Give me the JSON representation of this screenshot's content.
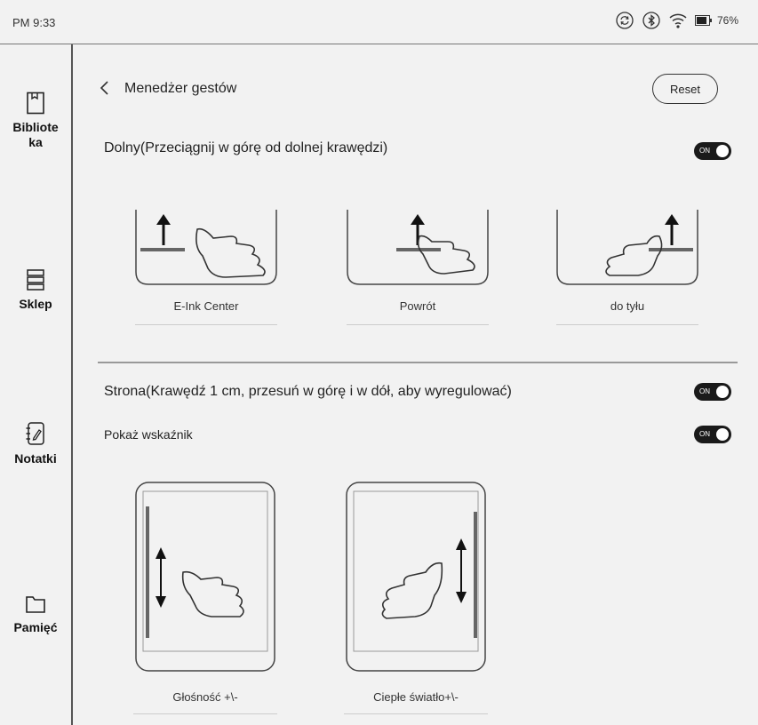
{
  "status": {
    "time": "PM 9:33",
    "battery": "76%"
  },
  "nav": {
    "items": [
      {
        "label_line1": "Bibliote",
        "label_line2": "ka",
        "icon": "library-icon"
      },
      {
        "label_line1": "Sklep",
        "label_line2": "",
        "icon": "store-icon"
      },
      {
        "label_line1": "Notatki",
        "label_line2": "",
        "icon": "notes-icon"
      },
      {
        "label_line1": "Pamięć",
        "label_line2": "",
        "icon": "storage-folder-icon"
      }
    ]
  },
  "header": {
    "title": "Menedżer gestów",
    "reset_label": "Reset"
  },
  "bottom_section": {
    "title": "Dolny(Przeciągnij w górę od dolnej krawędzi)",
    "toggle_text": "ON",
    "gestures": [
      {
        "label": "E-Ink Center"
      },
      {
        "label": "Powrót"
      },
      {
        "label": "do tyłu"
      }
    ]
  },
  "side_section": {
    "title": "Strona(Krawędź 1 cm, przesuń w górę i w dół, aby wyregulować)",
    "toggle_text": "ON",
    "indicator_label": "Pokaż wskaźnik",
    "indicator_toggle_text": "ON",
    "gestures": [
      {
        "label": "Głośność +\\-"
      },
      {
        "label": "Ciepłe światło+\\-"
      }
    ]
  }
}
